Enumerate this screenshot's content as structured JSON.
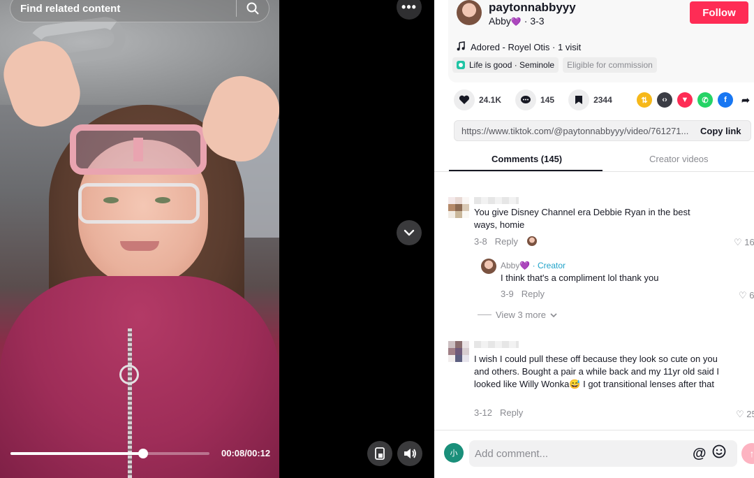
{
  "search": {
    "placeholder": "Find related content"
  },
  "player": {
    "time": "00:08/00:12",
    "progress": 0.667
  },
  "author": {
    "username": "paytonnabbyyy",
    "display_name": "Abby",
    "display_emoji": "💜",
    "post_date": "· 3-3",
    "follow_label": "Follow"
  },
  "music": {
    "text": "Adored - Royel Otis · 1 visit"
  },
  "tags": {
    "location": "Life is good · Seminole",
    "commission": "Eligible for commission"
  },
  "stats": {
    "likes": "24.1K",
    "comments": "145",
    "saves": "2344"
  },
  "share": {
    "icons": [
      "repost-icon",
      "embed-icon",
      "send-icon",
      "whatsapp-icon",
      "facebook-icon",
      "share-arrow-icon"
    ]
  },
  "link": {
    "url": "https://www.tiktok.com/@paytonnabbyyy/video/761271...",
    "copy_label": "Copy link"
  },
  "tabs": {
    "comments": "Comments (145)",
    "creator": "Creator videos"
  },
  "comments": [
    {
      "text": "You give Disney Channel era Debbie Ryan in the best ways, homie",
      "date": "3-8",
      "reply_label": "Reply",
      "likes": "16"
    },
    {
      "text": "I wish I could pull these off because they look so cute on you and others. Bought a pair a while back and my 11yr old said I looked like Willy Wonka😅 I got transitional lenses after that",
      "date": "3-12",
      "reply_label": "Reply",
      "likes": "25"
    }
  ],
  "reply": {
    "name": "Abby",
    "emoji": "💜",
    "badge": "· Creator",
    "text": "I think that's a compliment lol thank you",
    "date": "3-9",
    "reply_label": "Reply",
    "likes": "6"
  },
  "view_more": "View 3 more",
  "composer": {
    "placeholder": "Add comment...",
    "avatar_char": "小",
    "at": "@"
  },
  "colors": {
    "accent": "#fe2c55",
    "creator": "#20a3c9"
  }
}
